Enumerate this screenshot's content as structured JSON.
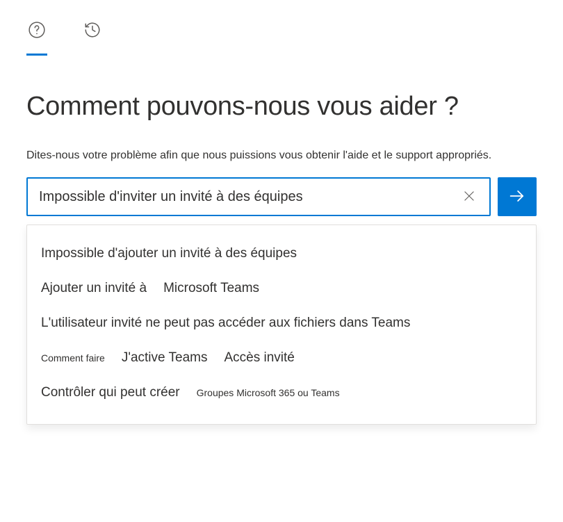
{
  "title": "Comment pouvons-nous vous aider ?",
  "subtitle": "Dites-nous votre problème afin que nous puissions vous obtenir l'aide et le support appropriés.",
  "search": {
    "value": "Impossible d'inviter un invité à des équipes",
    "placeholder": ""
  },
  "suggestions": [
    {
      "parts": [
        {
          "text": "Impossible d'ajouter un invité à des équipes",
          "size": "normal"
        }
      ]
    },
    {
      "parts": [
        {
          "text": "Ajouter un invité à",
          "size": "normal"
        },
        {
          "text": "Microsoft Teams",
          "size": "normal"
        }
      ]
    },
    {
      "parts": [
        {
          "text": "L'utilisateur invité ne peut pas accéder aux fichiers dans Teams",
          "size": "normal"
        }
      ]
    },
    {
      "parts": [
        {
          "text": "Comment faire",
          "size": "small"
        },
        {
          "text": "J'active Teams",
          "size": "normal"
        },
        {
          "text": "Accès invité",
          "size": "normal"
        }
      ]
    },
    {
      "parts": [
        {
          "text": "Contrôler qui peut créer",
          "size": "normal"
        },
        {
          "text": "Groupes Microsoft 365 ou Teams",
          "size": "small"
        }
      ]
    }
  ],
  "colors": {
    "accent": "#0078d4"
  }
}
